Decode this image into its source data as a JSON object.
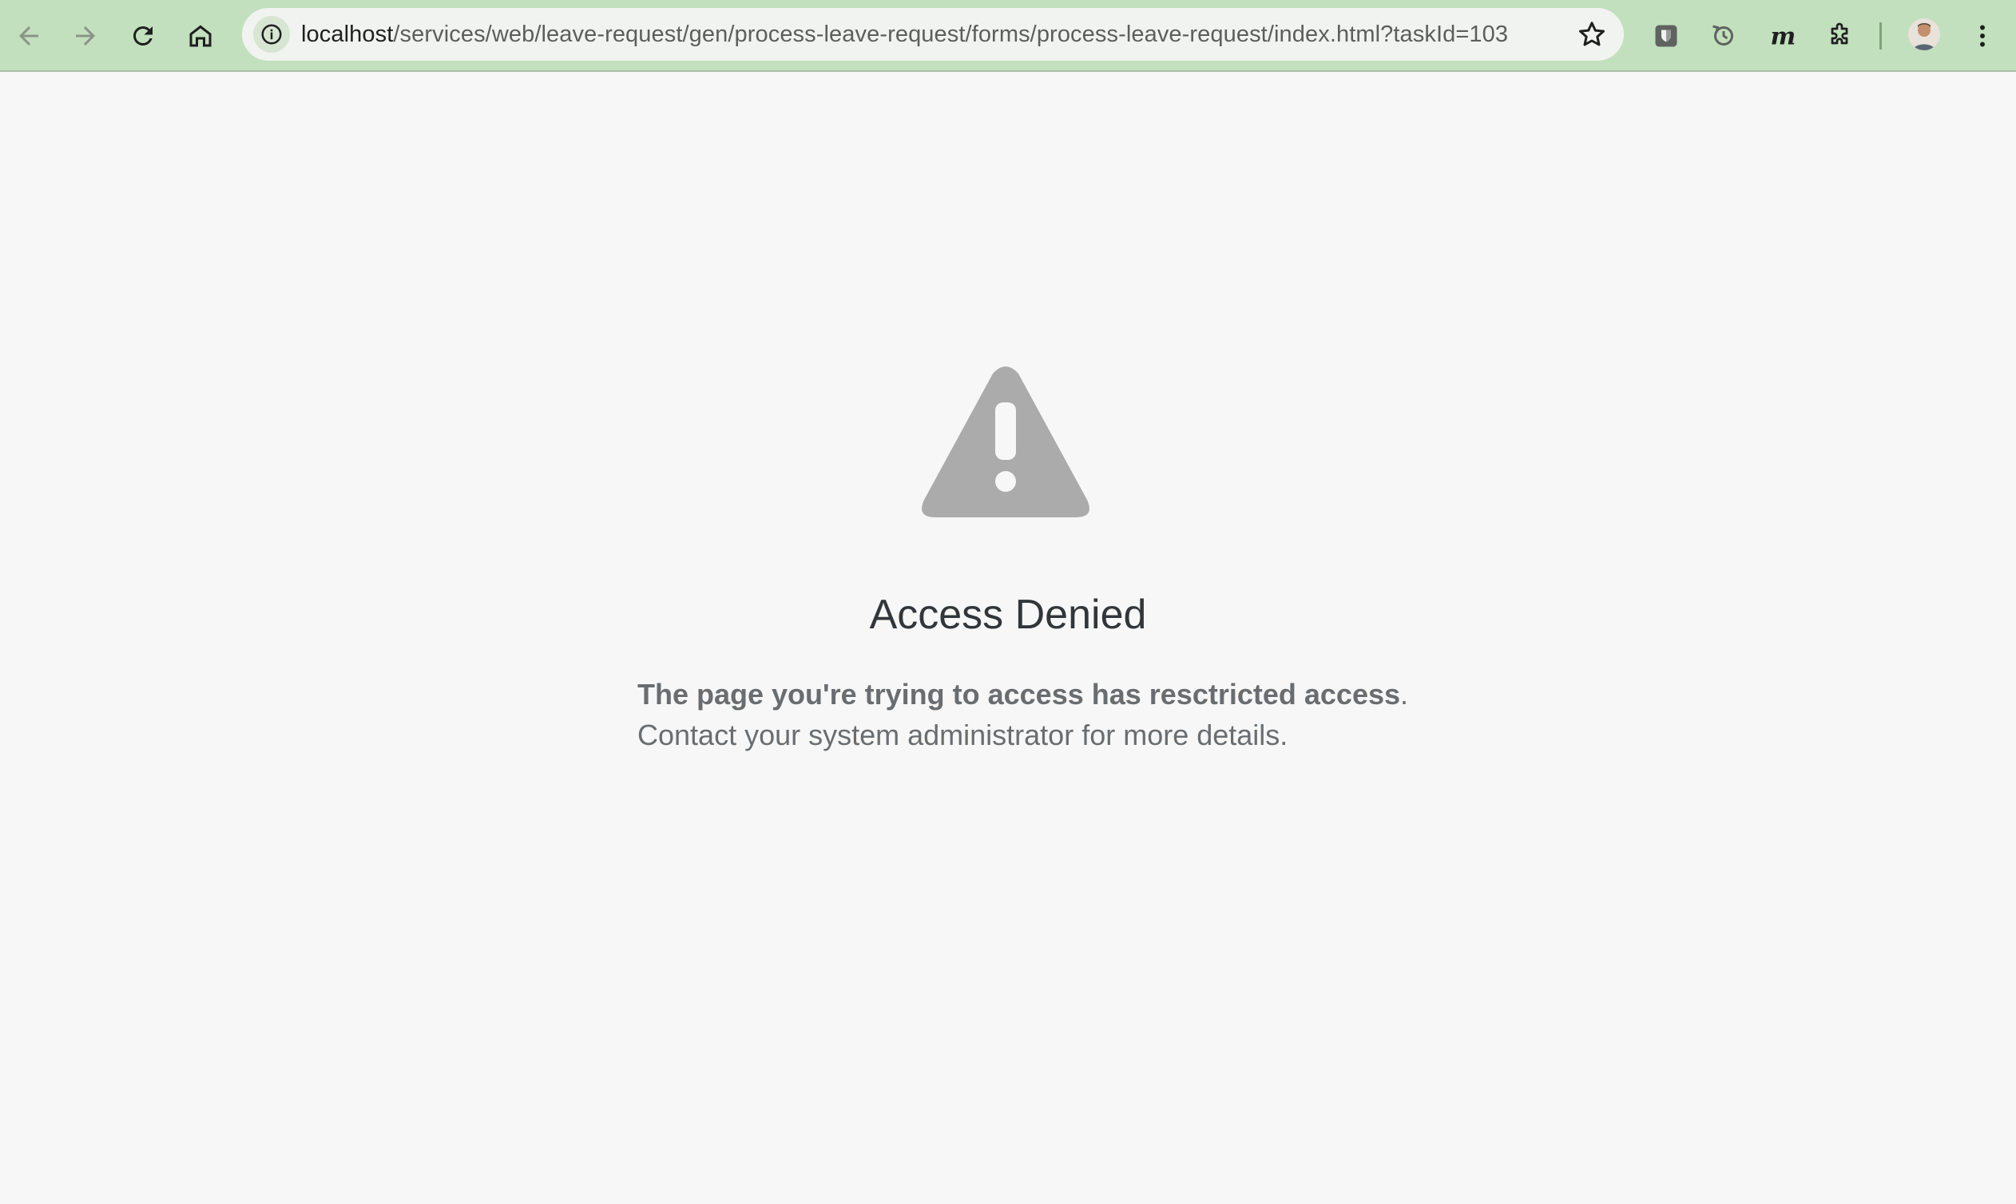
{
  "browser": {
    "url_host": "localhost",
    "url_path": "/services/web/leave-request/gen/process-leave-request/forms/process-leave-request/index.html?taskId=103",
    "icons": {
      "back": "arrow-left-icon",
      "forward": "arrow-right-icon",
      "reload": "reload-icon",
      "home": "home-icon",
      "site_info": "info-icon",
      "bookmark": "star-icon",
      "extensions": [
        "shield-extension-icon",
        "sync-extension-icon",
        "m-extension-icon",
        "puzzle-icon"
      ],
      "profile": "avatar",
      "menu": "kebab-menu-icon"
    },
    "toolbar_color": "#c2e0bd"
  },
  "error": {
    "icon": "warning-triangle-icon",
    "title": "Access Denied",
    "message_bold": "The page you're trying to access has resctricted access",
    "message_period": ".",
    "message_detail": "Contact your system administrator for more details."
  }
}
